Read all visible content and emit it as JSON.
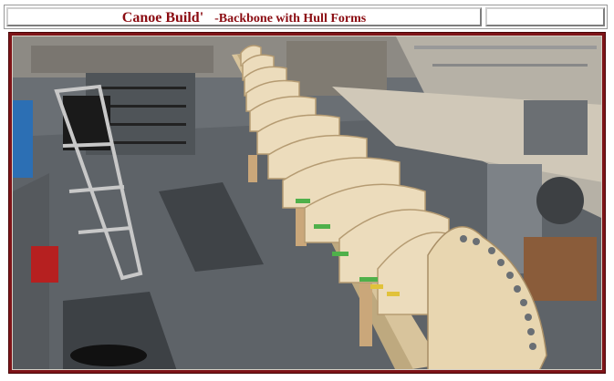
{
  "header": {
    "title": "Canoe Build'",
    "subtitle": "-Backbone with Hull Forms"
  },
  "photo": {
    "subject": "canoe-strongback-with-plywood-hull-forms"
  },
  "colors": {
    "title_text": "#8b0c12",
    "frame": "#7e1418",
    "floor": "#5f6468",
    "plywood": "#e9d8b6"
  }
}
